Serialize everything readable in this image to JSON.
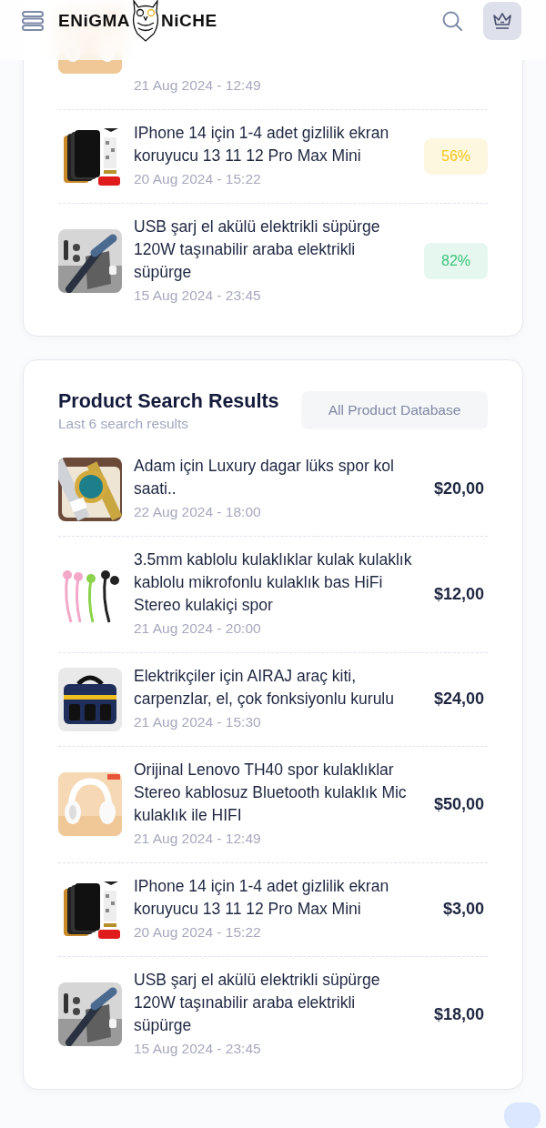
{
  "header": {
    "logo_left": "ENiGMA",
    "logo_right": "NiCHE"
  },
  "recent_card": {
    "items": [
      {
        "date": "21 Aug 2024 - 12:49"
      },
      {
        "title": "IPhone 14 için 1-4 adet gizlilik ekran koruyucu 13 11 12 Pro Max Mini",
        "date": "20 Aug 2024 - 15:22",
        "score": "56%",
        "color": "#f5c518"
      },
      {
        "title": "USB şarj el akülü elektrikli süpürge 120W taşınabilir araba elektrikli süpürge",
        "date": "15 Aug 2024 - 23:45",
        "score": "82%",
        "color": "#3cc47c"
      }
    ]
  },
  "search_results": {
    "title": "Product Search Results",
    "subtitle": "Last 6 search results",
    "button": "All Product Database",
    "rows": [
      {
        "title": "Adam için Luxury dagar lüks spor kol saati..",
        "date": "22 Aug 2024 - 18:00",
        "price": "$20,00"
      },
      {
        "title": "3.5mm kablolu kulaklıklar kulak kulaklık kablolu mikrofonlu kulaklık bas HiFi Stereo kulakiçi spor",
        "date": "21 Aug 2024 - 20:00",
        "price": "$12,00"
      },
      {
        "title": "Elektrikçiler için AIRAJ araç kiti, carpenzlar, el, çok fonksiyonlu kurulu",
        "date": "21 Aug 2024 - 15:30",
        "price": "$24,00"
      },
      {
        "title": "Orijinal Lenovo TH40 spor kulaklıklar Stereo kablosuz Bluetooth kulaklık Mic kulaklık ile HIFI",
        "date": "21 Aug 2024 - 12:49",
        "price": "$50,00"
      },
      {
        "title": "IPhone 14 için 1-4 adet gizlilik ekran koruyucu 13 11 12 Pro Max Mini",
        "date": "20 Aug 2024 - 15:22",
        "price": "$3,00"
      },
      {
        "title": "USB şarj el akülü elektrikli süpürge 120W taşınabilir araba elektrikli süpürge",
        "date": "15 Aug 2024 - 23:45",
        "price": "$18,00"
      }
    ]
  }
}
